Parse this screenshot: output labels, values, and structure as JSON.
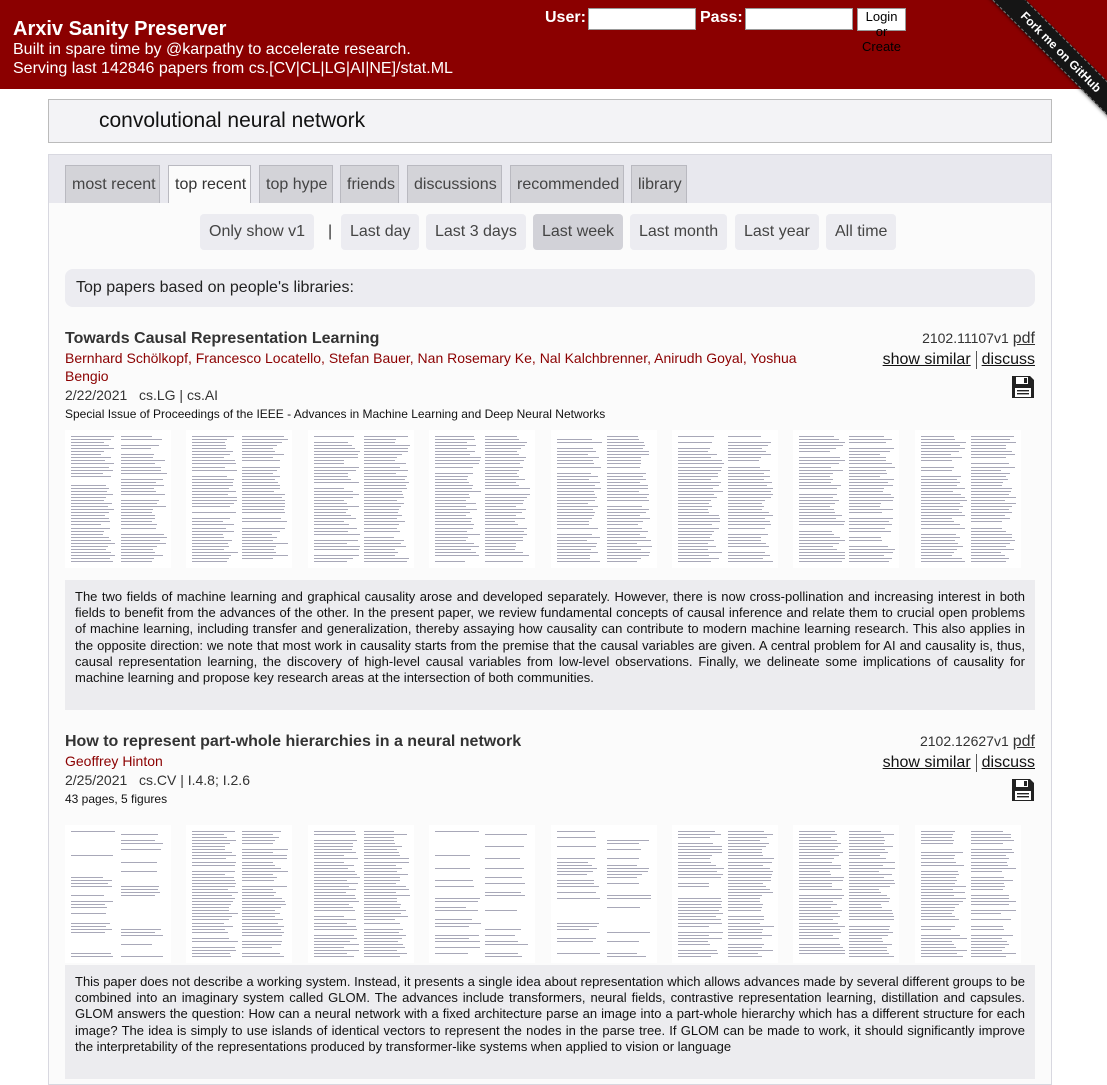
{
  "header": {
    "title": "Arxiv Sanity Preserver",
    "subtitle1": "Built in spare time by @karpathy to accelerate research.",
    "subtitle2": "Serving last 142846 papers from cs.[CV|CL|LG|AI|NE]/stat.ML",
    "user_label": "User:",
    "pass_label": "Pass:",
    "user_value": "",
    "pass_value": "",
    "login_button": "Login or Create",
    "fork_ribbon": "Fork me on GitHub"
  },
  "search": {
    "query": "convolutional neural network"
  },
  "tabs": [
    {
      "label": "most recent",
      "active": false
    },
    {
      "label": "top recent",
      "active": true
    },
    {
      "label": "top hype",
      "active": false
    },
    {
      "label": "friends",
      "active": false
    },
    {
      "label": "discussions",
      "active": false
    },
    {
      "label": "recommended",
      "active": false
    },
    {
      "label": "library",
      "active": false
    }
  ],
  "filters": {
    "only_v1": "Only show v1",
    "separator": "|",
    "ranges": [
      {
        "label": "Last day",
        "active": false
      },
      {
        "label": "Last 3 days",
        "active": false
      },
      {
        "label": "Last week",
        "active": true
      },
      {
        "label": "Last month",
        "active": false
      },
      {
        "label": "Last year",
        "active": false
      },
      {
        "label": "All time",
        "active": false
      }
    ]
  },
  "info_text": "Top papers based on people's libraries:",
  "papers": [
    {
      "title": "Towards Causal Representation Learning",
      "authors": "Bernhard Schölkopf, Francesco Locatello, Stefan Bauer, Nan Rosemary Ke, Nal Kalchbrenner, Anirudh Goyal, Yoshua Bengio",
      "date": "2/22/2021",
      "categories": "cs.LG | cs.AI",
      "comment": "Special Issue of Proceedings of the IEEE - Advances in Machine Learning and Deep Neural Networks",
      "arxiv_id": "2102.11107v1",
      "pdf_label": "pdf",
      "show_similar": "show similar",
      "discuss": "discuss",
      "save_icon": "floppy-disk-icon",
      "abstract": "The two fields of machine learning and graphical causality arose and developed separately. However, there is now cross-pollination and increasing interest in both fields to benefit from the advances of the other. In the present paper, we review fundamental concepts of causal inference and relate them to crucial open problems of machine learning, including transfer and generalization, thereby assaying how causality can contribute to modern machine learning research. This also applies in the opposite direction: we note that most work in causality starts from the premise that the causal variables are given. A central problem for AI and causality is, thus, causal representation learning, the discovery of high-level causal variables from low-level observations. Finally, we delineate some implications of causality for machine learning and propose key research areas at the intersection of both communities."
    },
    {
      "title": "How to represent part-whole hierarchies in a neural network",
      "authors": "Geoffrey Hinton",
      "date": "2/25/2021",
      "categories": "cs.CV | I.4.8; I.2.6",
      "comment": "43 pages, 5 figures",
      "arxiv_id": "2102.12627v1",
      "pdf_label": "pdf",
      "show_similar": "show similar",
      "discuss": "discuss",
      "save_icon": "floppy-disk-icon",
      "abstract": "This paper does not describe a working system. Instead, it presents a single idea about representation which allows advances made by several different groups to be combined into an imaginary system called GLOM. The advances include transformers, neural fields, contrastive representation learning, distillation and capsules. GLOM answers the question: How can a neural network with a fixed architecture parse an image into a part-whole hierarchy which has a different structure for each image? The idea is simply to use islands of identical vectors to represent the nodes in the parse tree. If GLOM can be made to work, it should significantly improve the interpretability of the representations produced by transformer-like systems when applied to vision or language"
    }
  ]
}
